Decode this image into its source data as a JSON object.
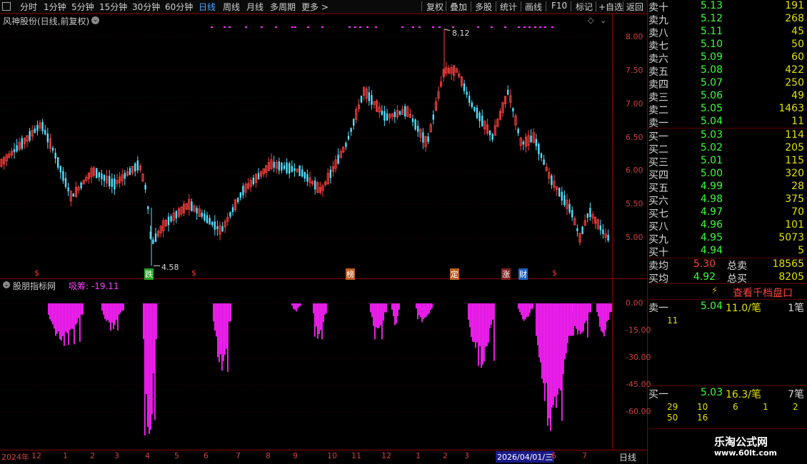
{
  "toolbar": {
    "periods": [
      "分时",
      "1分钟",
      "5分钟",
      "15分钟",
      "30分钟",
      "60分钟",
      "日线",
      "周线",
      "月线",
      "多周期",
      "更多 >"
    ],
    "active": "日线",
    "actions": [
      "复权",
      "叠加",
      "多股",
      "统计",
      "画线",
      "F10",
      "标记",
      "+自选",
      "返回"
    ]
  },
  "chart": {
    "title": "风神股份(日线,前复权)",
    "y_ticks": [
      "8.00",
      "7.50",
      "7.00",
      "6.50",
      "6.00",
      "5.50",
      "5.00"
    ],
    "max_label": "8.12",
    "min_label": "4.58",
    "tags": [
      {
        "text": "跌",
        "color": "#2aa52a"
      },
      {
        "text": "榜",
        "color": "#c06020"
      },
      {
        "text": "定",
        "color": "#c06020"
      },
      {
        "text": "涨",
        "color": "#c03030"
      },
      {
        "text": "财",
        "color": "#2060c0"
      }
    ],
    "s_mark": "$"
  },
  "indicator": {
    "title": "股朋指标网",
    "label": "吸筹: -19.11",
    "y_ticks": [
      "0.00",
      "-15.00",
      "-30.00",
      "-45.00",
      "-60.00"
    ],
    "color": "#ff20ff"
  },
  "xaxis": {
    "labels": [
      "2024年",
      "12",
      "1",
      "2",
      "3",
      "4",
      "5",
      "6",
      "7",
      "8",
      "9",
      "10",
      "11",
      "12",
      "1",
      "2",
      "3",
      "2026/04/01/三",
      "6",
      "7"
    ],
    "period": "日线"
  },
  "orderbook": {
    "asks": [
      {
        "label": "卖十",
        "price": "5.13",
        "vol": "191"
      },
      {
        "label": "卖九",
        "price": "5.12",
        "vol": "268"
      },
      {
        "label": "卖八",
        "price": "5.11",
        "vol": "45"
      },
      {
        "label": "卖七",
        "price": "5.10",
        "vol": "50"
      },
      {
        "label": "卖六",
        "price": "5.09",
        "vol": "60"
      },
      {
        "label": "卖五",
        "price": "5.08",
        "vol": "422"
      },
      {
        "label": "卖四",
        "price": "5.07",
        "vol": "250"
      },
      {
        "label": "卖三",
        "price": "5.06",
        "vol": "49"
      },
      {
        "label": "卖二",
        "price": "5.05",
        "vol": "1463"
      },
      {
        "label": "卖一",
        "price": "5.04",
        "vol": "11"
      }
    ],
    "bids": [
      {
        "label": "买一",
        "price": "5.03",
        "vol": "114"
      },
      {
        "label": "买二",
        "price": "5.02",
        "vol": "205"
      },
      {
        "label": "买三",
        "price": "5.01",
        "vol": "115"
      },
      {
        "label": "买四",
        "price": "5.00",
        "vol": "320"
      },
      {
        "label": "买五",
        "price": "4.99",
        "vol": "28"
      },
      {
        "label": "买六",
        "price": "4.98",
        "vol": "375"
      },
      {
        "label": "买七",
        "price": "4.97",
        "vol": "70"
      },
      {
        "label": "买八",
        "price": "4.96",
        "vol": "101"
      },
      {
        "label": "买九",
        "price": "4.95",
        "vol": "5073"
      },
      {
        "label": "买十",
        "price": "4.94",
        "vol": "5"
      }
    ],
    "avg_sell": {
      "label": "卖均",
      "price": "5.30",
      "total_label": "总卖",
      "total": "18565"
    },
    "avg_buy": {
      "label": "买均",
      "price": "4.92",
      "total_label": "总买",
      "total": "8205"
    },
    "view_1000": "查看千档盘口",
    "ask1": {
      "label": "卖一",
      "price": "5.04",
      "avg": "11.0/笔",
      "count": "1笔",
      "queue": [
        "11"
      ]
    },
    "bid1": {
      "label": "买一",
      "price": "5.03",
      "avg": "16.3/笔",
      "count": "7笔",
      "queue": [
        "29",
        "10",
        "6",
        "1",
        "2",
        "50",
        "16"
      ]
    }
  },
  "watermark": {
    "name": "乐淘公式网",
    "url": "www.60lt.com"
  },
  "colors": {
    "up": "#ff4040",
    "down": "#50e0ff",
    "border": "#8a0000"
  }
}
